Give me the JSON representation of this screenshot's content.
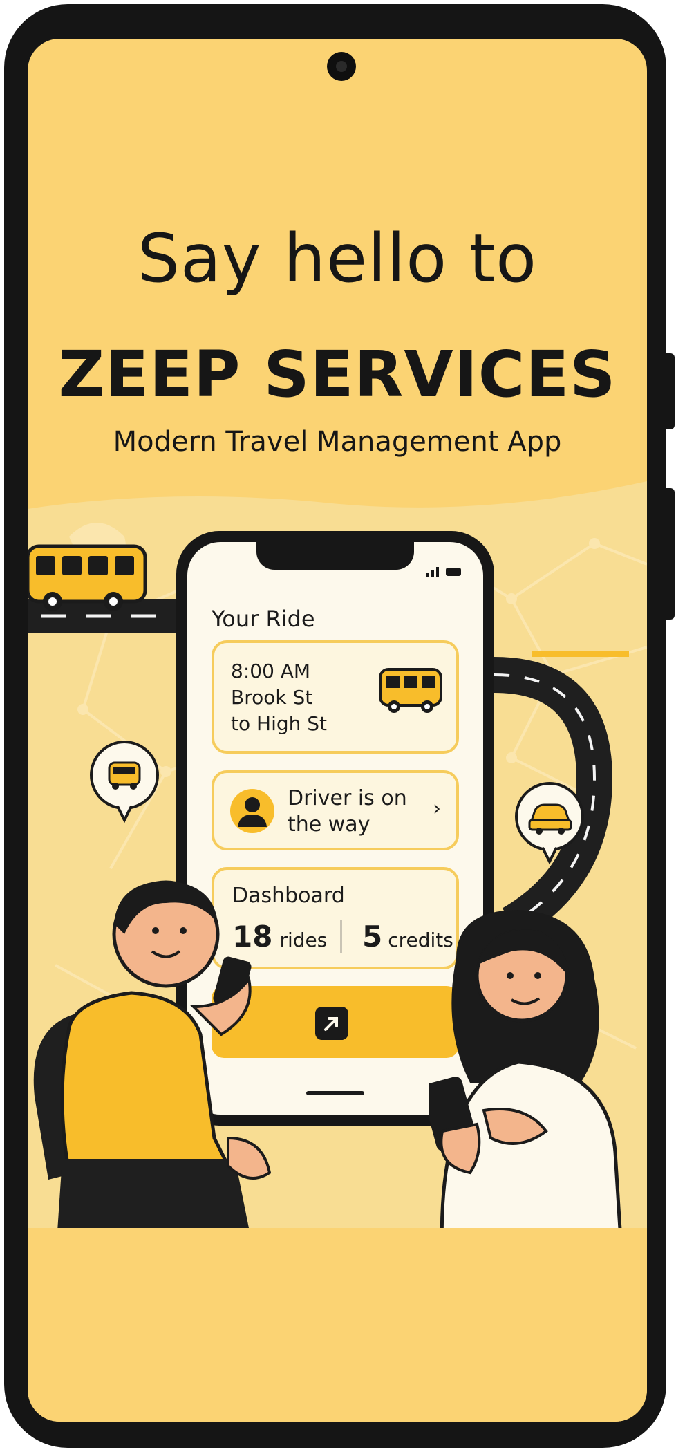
{
  "headline": {
    "greeting": "Say hello  to",
    "brand": "ZEEP SERVICES",
    "tagline": "Modern Travel Management App"
  },
  "mock_app": {
    "section_title": "Your Ride",
    "ride": {
      "time": "8:00 AM",
      "from": "Brook St",
      "to": "to High St"
    },
    "driver_status": {
      "line1": "Driver is on",
      "line2": "the way"
    },
    "dashboard": {
      "title": "Dashboard",
      "rides_count": "18",
      "rides_label": "rides",
      "credits_count": "5",
      "credits_label": "credits"
    }
  },
  "colors": {
    "background": "#fbd373",
    "accent": "#f8bd2b",
    "dark": "#171717",
    "card": "#fdf6df",
    "card_border": "#f6cc5c"
  },
  "icons": [
    "bus-icon",
    "person-icon",
    "chevron-right-icon",
    "arrow-up-right-icon",
    "signal-icon",
    "battery-icon",
    "car-icon"
  ]
}
